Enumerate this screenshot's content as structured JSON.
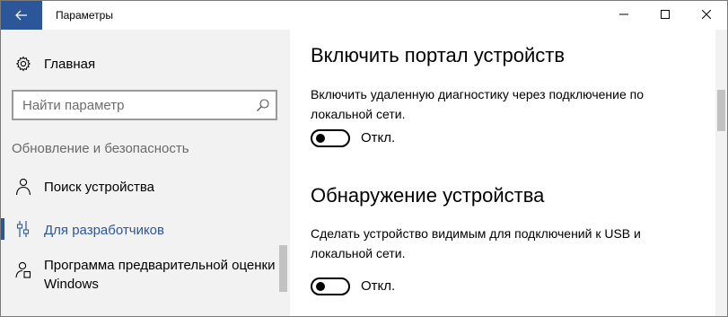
{
  "window": {
    "title": "Параметры",
    "icons": {
      "back": "back-arrow-icon",
      "minimize": "minimize-icon",
      "maximize": "maximize-icon",
      "close": "close-icon"
    }
  },
  "sidebar": {
    "home_label": "Главная",
    "home_icon": "gear-icon",
    "search": {
      "placeholder": "Найти параметр",
      "icon": "search-icon"
    },
    "section_header": "Обновление и безопасность",
    "items": [
      {
        "label": "Поиск устройства",
        "icon": "person-locate-icon",
        "active": false
      },
      {
        "label": "Для разработчиков",
        "icon": "developer-tools-icon",
        "active": true
      },
      {
        "label": "Программа предварительной оценки",
        "label2": "Windows",
        "icon": "insider-person-icon",
        "active": false
      }
    ],
    "accent_color": "#2b579a"
  },
  "main": {
    "sections": [
      {
        "heading": "Включить портал устройств",
        "description": "Включить удаленную диагностику через подключение по локальной сети.",
        "toggle": {
          "state": "off",
          "label": "Откл."
        }
      },
      {
        "heading": "Обнаружение устройства",
        "description": "Сделать устройство видимым для подключений к USB и локальной сети.",
        "toggle": {
          "state": "off",
          "label": "Откл."
        }
      }
    ]
  }
}
